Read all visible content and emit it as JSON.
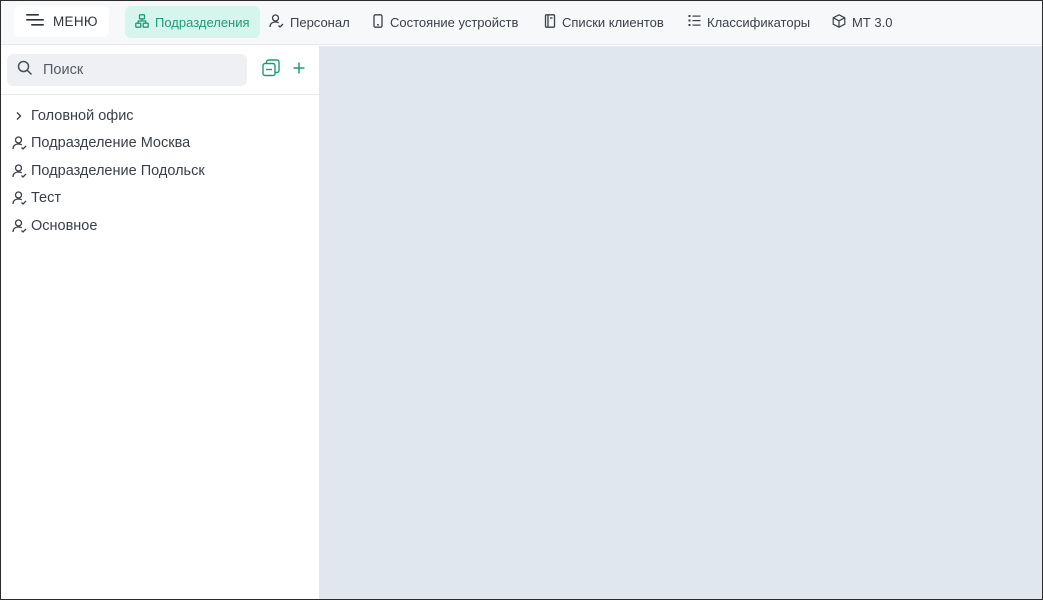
{
  "topbar": {
    "menu_label": "МЕНЮ",
    "tabs": [
      {
        "label": "Подразделения",
        "icon": "org-structure-icon",
        "active": true
      },
      {
        "label": "Персонал",
        "icon": "user-icon",
        "active": false
      },
      {
        "label": "Состояние устройств",
        "icon": "mobile-device-icon",
        "active": false
      },
      {
        "label": "Списки клиентов",
        "icon": "book-icon",
        "active": false
      },
      {
        "label": "Классификаторы",
        "icon": "list-icon",
        "active": false
      },
      {
        "label": "МТ 3.0",
        "icon": "cube-icon",
        "active": false
      }
    ]
  },
  "sidebar": {
    "search": {
      "placeholder": "Поиск",
      "value": ""
    },
    "tree": [
      {
        "label": "Головной офис",
        "icon": "chevron-right-icon"
      },
      {
        "label": "Подразделение Москва",
        "icon": "user-icon"
      },
      {
        "label": "Подразделение Подольск",
        "icon": "user-icon"
      },
      {
        "label": "Тест",
        "icon": "user-icon"
      },
      {
        "label": "Основное",
        "icon": "user-icon"
      }
    ]
  },
  "colors": {
    "accent": "#1f9a78",
    "accent_bg": "#d6f5ec",
    "main_bg": "#e1e7ef",
    "topbar_bg": "#f7f8fa",
    "search_bg": "#eef0f4"
  }
}
